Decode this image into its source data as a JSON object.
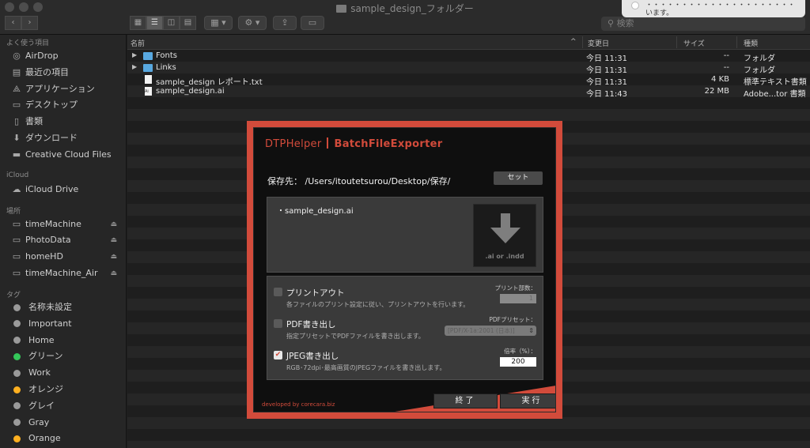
{
  "window": {
    "title": "sample_design_フォルダー",
    "search_placeholder": "検索"
  },
  "notification": {
    "text": "・・・・・・・・・・・・・・・・・・・・・います。"
  },
  "sidebar": {
    "favorites_title": "よく使う項目",
    "favorites": [
      {
        "label": "AirDrop",
        "icon": "airdrop-icon"
      },
      {
        "label": "最近の項目",
        "icon": "recent-icon"
      },
      {
        "label": "アプリケーション",
        "icon": "applications-icon"
      },
      {
        "label": "デスクトップ",
        "icon": "desktop-icon"
      },
      {
        "label": "書類",
        "icon": "documents-icon"
      },
      {
        "label": "ダウンロード",
        "icon": "download-icon"
      },
      {
        "label": "Creative Cloud Files",
        "icon": "folder-icon"
      }
    ],
    "icloud_title": "iCloud",
    "icloud": [
      {
        "label": "iCloud Drive",
        "icon": "cloud-icon"
      }
    ],
    "locations_title": "場所",
    "locations": [
      {
        "label": "timeMachine"
      },
      {
        "label": "PhotoData"
      },
      {
        "label": "homeHD"
      },
      {
        "label": "timeMachine_Air"
      }
    ],
    "tags_title": "タグ",
    "tags": [
      {
        "label": "名称未設定",
        "color": "#9a9a9a"
      },
      {
        "label": "Important",
        "color": "#9a9a9a"
      },
      {
        "label": "Home",
        "color": "#9a9a9a"
      },
      {
        "label": "グリーン",
        "color": "#34c759"
      },
      {
        "label": "Work",
        "color": "#9a9a9a"
      },
      {
        "label": "オレンジ",
        "color": "#ffb020"
      },
      {
        "label": "グレイ",
        "color": "#9a9a9a"
      },
      {
        "label": "Gray",
        "color": "#9a9a9a"
      },
      {
        "label": "Orange",
        "color": "#ffb020"
      }
    ]
  },
  "file_list": {
    "columns": {
      "name": "名前",
      "modified": "変更日",
      "size": "サイズ",
      "kind": "種類"
    },
    "rows": [
      {
        "name": "Fonts",
        "modified": "今日 11:31",
        "size": "--",
        "kind": "フォルダ",
        "type": "folder"
      },
      {
        "name": "Links",
        "modified": "今日 11:31",
        "size": "--",
        "kind": "フォルダ",
        "type": "folder"
      },
      {
        "name": "sample_design レポート.txt",
        "modified": "今日 11:31",
        "size": "4 KB",
        "kind": "標準テキスト書類",
        "type": "doc"
      },
      {
        "name": "sample_design.ai",
        "modified": "今日 11:43",
        "size": "22 MB",
        "kind": "Adobe...tor 書類",
        "type": "ai"
      }
    ]
  },
  "dialog": {
    "brand_left": "DTPHelper",
    "brand_right": "BatchFileExporter",
    "save_label": "保存先：",
    "save_path": "/Users/itoutetsurou/Desktop/保存/",
    "set_button": "セット",
    "files": [
      "・sample_design.ai"
    ],
    "drop_hint": ".ai  or  .indd",
    "options": {
      "print": {
        "title": "プリントアウト",
        "desc": "各ファイルのプリント設定に従い、プリントアウトを行います。",
        "sublabel": "プリント部数：",
        "value": "1",
        "checked": false
      },
      "pdf": {
        "title": "PDF書き出し",
        "desc": "指定プリセットでPDFファイルを書き出します。",
        "sublabel": "PDFプリセット：",
        "value": "[PDF/X-1a:2001 (日本)]",
        "checked": false
      },
      "jpeg": {
        "title": "JPEG書き出し",
        "desc": "RGB･72dpi･最高画質のJPEGファイルを書き出します。",
        "sublabel": "倍率（%）：",
        "value": "200",
        "checked": true
      }
    },
    "credit": "developed by corecara.biz",
    "quit_button": "終了",
    "run_button": "実行",
    "accent_color": "#d24b3b"
  }
}
